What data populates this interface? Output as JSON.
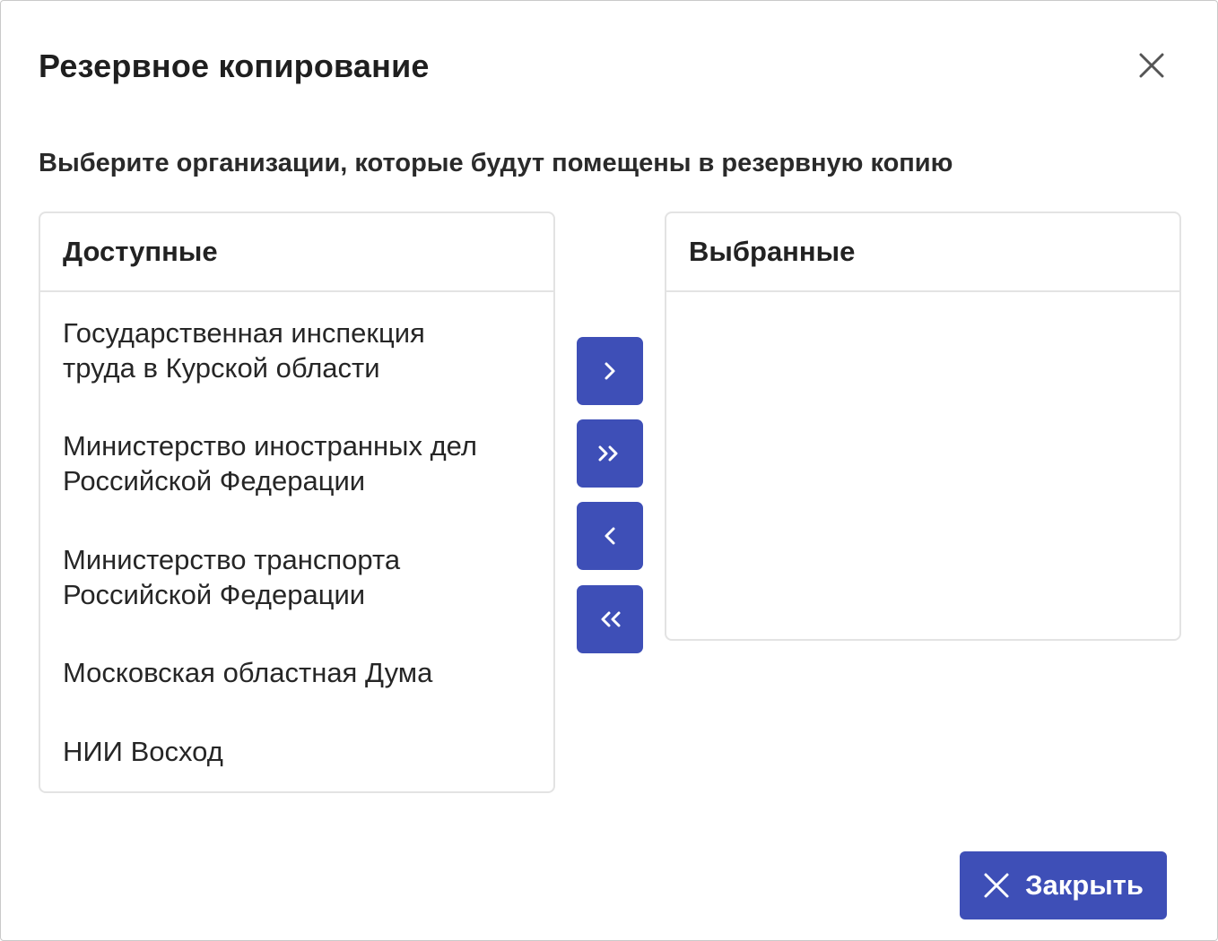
{
  "dialog": {
    "title": "Резервное копирование",
    "subtitle": "Выберите организации, которые будут помещены в резервную копию",
    "close_icon": "close-icon"
  },
  "available": {
    "header": "Доступные",
    "items": [
      {
        "line1": "Государственная инспекция",
        "line2": "труда в Курской области"
      },
      {
        "line1": "Министерство иностранных дел",
        "line2": "Российской Федерации"
      },
      {
        "line1": "Министерство транспорта",
        "line2": "Российской Федерации"
      },
      {
        "line1": "Московская областная Дума",
        "line2": ""
      },
      {
        "line1": "НИИ Восход",
        "line2": ""
      }
    ]
  },
  "selected": {
    "header": "Выбранные",
    "items": []
  },
  "transfer_buttons": {
    "move_right_icon": "chevron-right-icon",
    "move_all_right_icon": "double-chevron-right-icon",
    "move_left_icon": "chevron-left-icon",
    "move_all_left_icon": "double-chevron-left-icon"
  },
  "footer": {
    "close_label": "Закрыть",
    "close_icon": "close-icon"
  },
  "colors": {
    "accent": "#3e4fb7",
    "border": "#e3e3e3",
    "text": "#222222"
  }
}
